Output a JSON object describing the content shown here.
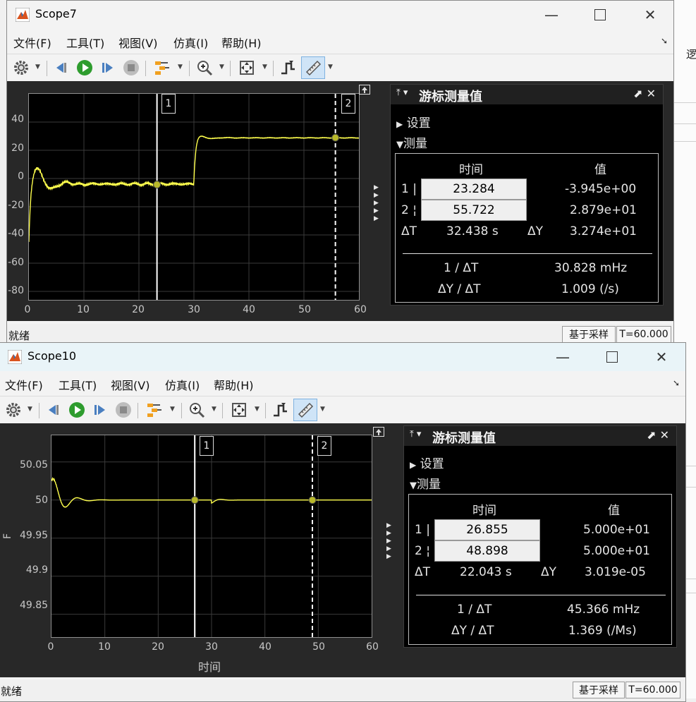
{
  "background": {
    "fragment": "逻"
  },
  "scope7": {
    "title": "Scope7",
    "menu": [
      "文件(F)",
      "工具(T)",
      "视图(V)",
      "仿真(I)",
      "帮助(H)"
    ],
    "plot": {
      "y_ticks": [
        "40",
        "20",
        "0",
        "-20",
        "-40",
        "-60",
        "-80"
      ],
      "x_ticks": [
        "0",
        "10",
        "20",
        "30",
        "40",
        "50",
        "60"
      ]
    },
    "cursors": {
      "c1_label": "1",
      "c2_label": "2"
    },
    "panel": {
      "title": "游标测量值",
      "settings_label": "设置",
      "measure_label": "测量",
      "time_header": "时间",
      "value_header": "值",
      "row1_label": "1",
      "row2_label": "2",
      "t1": "23.284",
      "t2": "55.722",
      "v1": "-3.945e+00",
      "v2": "2.879e+01",
      "dt_label": "ΔT",
      "dt_value": "32.438 s",
      "dy_label": "ΔY",
      "dy_value": "3.274e+01",
      "inv_dt_label": "1 / ΔT",
      "inv_dt_value": "30.828 mHz",
      "slope_label": "ΔY / ΔT",
      "slope_value": "1.009 (/s)"
    },
    "status": {
      "left": "就绪",
      "mode": "基于采样",
      "time": "T=60.000"
    }
  },
  "scope10": {
    "title": "Scope10",
    "menu": [
      "文件(F)",
      "工具(T)",
      "视图(V)",
      "仿真(I)",
      "帮助(H)"
    ],
    "plot": {
      "y_ticks": [
        "50.05",
        "50",
        "49.95",
        "49.9",
        "49.85"
      ],
      "x_ticks": [
        "0",
        "10",
        "20",
        "30",
        "40",
        "50",
        "60"
      ],
      "ylabel": "F",
      "xlabel": "时间"
    },
    "cursors": {
      "c1_label": "1",
      "c2_label": "2"
    },
    "panel": {
      "title": "游标测量值",
      "settings_label": "设置",
      "measure_label": "测量",
      "time_header": "时间",
      "value_header": "值",
      "row1_label": "1",
      "row2_label": "2",
      "t1": "26.855",
      "t2": "48.898",
      "v1": "5.000e+01",
      "v2": "5.000e+01",
      "dt_label": "ΔT",
      "dt_value": "22.043 s",
      "dy_label": "ΔY",
      "dy_value": "3.019e-05",
      "inv_dt_label": "1 / ΔT",
      "inv_dt_value": "45.366 mHz",
      "slope_label": "ΔY / ΔT",
      "slope_value": "1.369 (/Ms)"
    },
    "status": {
      "left": "就绪",
      "mode": "基于采样",
      "time": "T=60.000"
    }
  },
  "colors": {
    "signal": "#ffff4d",
    "cursor_dot": "#b8b82a",
    "panel_bg": "#000000",
    "canvas_bg": "#282828"
  },
  "icons": [
    "matlab-icon",
    "gear-icon",
    "step-back-icon",
    "run-icon",
    "step-forward-icon",
    "stop-icon",
    "signal-select-icon",
    "zoom-icon",
    "fit-icon",
    "triggers-icon",
    "cursor-measure-icon",
    "minimize-icon",
    "maximize-icon",
    "close-icon",
    "undock-icon",
    "pin-icon"
  ]
}
